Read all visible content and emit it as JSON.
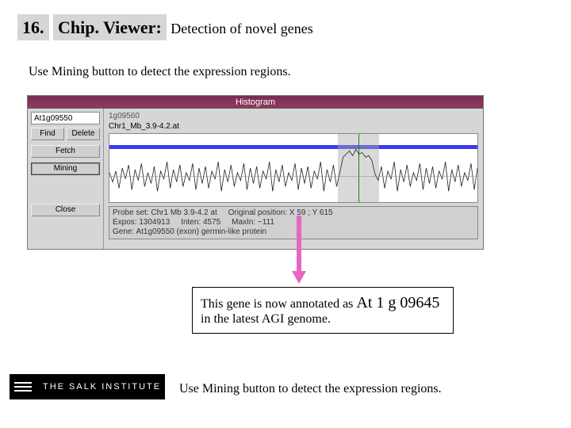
{
  "title": {
    "number": "16.",
    "main": "Chip. Viewer:",
    "sub": "Detection of novel genes"
  },
  "lead": "Use Mining button to detect the expression regions.",
  "app": {
    "window_title": "Histogram",
    "gene_field_value": "At1g09550",
    "buttons": {
      "find": "Find",
      "delete": "Delete",
      "fetch": "Fetch",
      "mining": "Mining",
      "close": "Close"
    },
    "main": {
      "track_label": "1g09560",
      "coord_label": "Chr1_Mb_3.9-4.2.at",
      "status": {
        "l1a": "Probe set:  Chr1  Mb 3.9-4.2 at",
        "l1b": "Original position: X 59 ; Y 615",
        "l2a": "Expos: 1304913",
        "l2b": "Inten: 4575",
        "l2c": "MaxIn: ~111",
        "l3": "Gene: At1g09550 (exon) germin-like protein"
      }
    }
  },
  "callout": {
    "line1_a": "This gene is now annotated as ",
    "gene_id": "At 1 g 09645",
    "line2": "in the latest AGI genome."
  },
  "logo_text": "THE SALK INSTITUTE",
  "footer": "Use Mining button to detect the expression regions."
}
